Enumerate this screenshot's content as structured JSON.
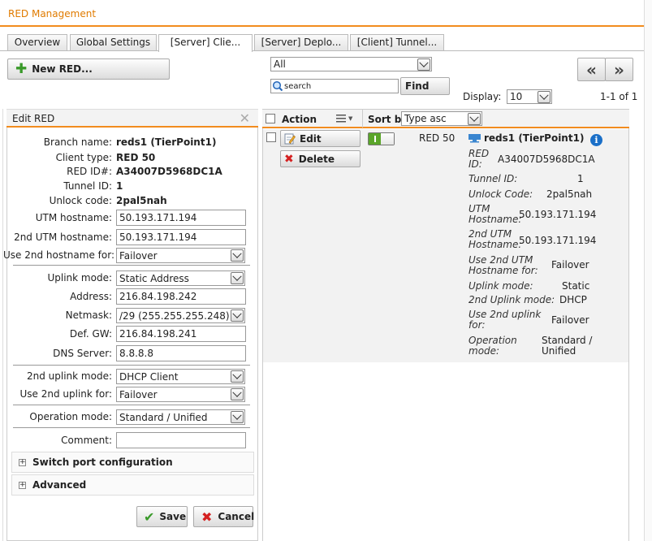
{
  "window": {
    "title": "RED Management"
  },
  "tabs": [
    {
      "label": "Overview"
    },
    {
      "label": "Global Settings"
    },
    {
      "label": "[Server] Clie..."
    },
    {
      "label": "[Server] Deplo..."
    },
    {
      "label": "[Client] Tunnel..."
    }
  ],
  "toolbar": {
    "new_red_label": "New RED...",
    "filter_value": "All",
    "search_placeholder": "search",
    "find_label": "Find",
    "display_label": "Display:",
    "display_value": "10",
    "pagination": "1-1 of 1",
    "prev_label": "«",
    "next_label": "»"
  },
  "edit_red": {
    "title": "Edit RED",
    "branch_name_label": "Branch name:",
    "branch_name_value": "reds1 (TierPoint1)",
    "client_type_label": "Client type:",
    "client_type_value": "RED 50",
    "red_id_label": "RED ID#:",
    "red_id_value": "A34007D5968DC1A",
    "tunnel_id_label": "Tunnel ID:",
    "tunnel_id_value": "1",
    "unlock_code_label": "Unlock code:",
    "unlock_code_value": "2pal5nah",
    "utm_hostname_label": "UTM hostname:",
    "utm_hostname_value": "50.193.171.194",
    "utm_hostname2_label": "2nd UTM hostname:",
    "utm_hostname2_value": "50.193.171.194",
    "use_2nd_hostname_label": "Use 2nd hostname for:",
    "use_2nd_hostname_value": "Failover",
    "uplink_mode_label": "Uplink mode:",
    "uplink_mode_value": "Static Address",
    "address_label": "Address:",
    "address_value": "216.84.198.242",
    "netmask_label": "Netmask:",
    "netmask_value": "/29 (255.255.255.248)",
    "def_gw_label": "Def. GW:",
    "def_gw_value": "216.84.198.241",
    "dns_label": "DNS Server:",
    "dns_value": "8.8.8.8",
    "uplink2_mode_label": "2nd uplink mode:",
    "uplink2_mode_value": "DHCP Client",
    "use_2nd_uplink_label": "Use 2nd uplink for:",
    "use_2nd_uplink_value": "Failover",
    "operation_mode_label": "Operation mode:",
    "operation_mode_value": "Standard / Unified",
    "comment_label": "Comment:",
    "comment_value": "",
    "switch_port_label": "Switch port configuration",
    "advanced_label": "Advanced",
    "save_label": "Save",
    "cancel_label": "Cancel"
  },
  "list": {
    "action_header": "Action",
    "sort_by_label": "Sort by:",
    "sort_value": "Type asc",
    "edit_label": "Edit",
    "delete_label": "Delete",
    "row_type": "RED 50",
    "row_name": "reds1 (TierPoint1)",
    "details": [
      {
        "label": "RED ID:",
        "value": "A34007D5968DC1A"
      },
      {
        "label": "Tunnel ID:",
        "value": "1"
      },
      {
        "label": "Unlock Code:",
        "value": "2pal5nah"
      },
      {
        "label": "UTM Hostname:",
        "value": "50.193.171.194"
      },
      {
        "label": "2nd UTM Hostname:",
        "value": "50.193.171.194"
      },
      {
        "label": "Use 2nd UTM Hostname for:",
        "value": "Failover"
      },
      {
        "label": "Uplink mode:",
        "value": "Static"
      },
      {
        "label": "2nd Uplink mode:",
        "value": "DHCP"
      },
      {
        "label": "Use 2nd uplink for:",
        "value": "Failover"
      },
      {
        "label": "Operation mode:",
        "value": "Standard / Unified"
      }
    ]
  },
  "colors": {
    "accent": "#f28c1e",
    "title": "#e07b00",
    "toggle_green": "#5aa52a",
    "info_blue": "#1a6fc8"
  }
}
